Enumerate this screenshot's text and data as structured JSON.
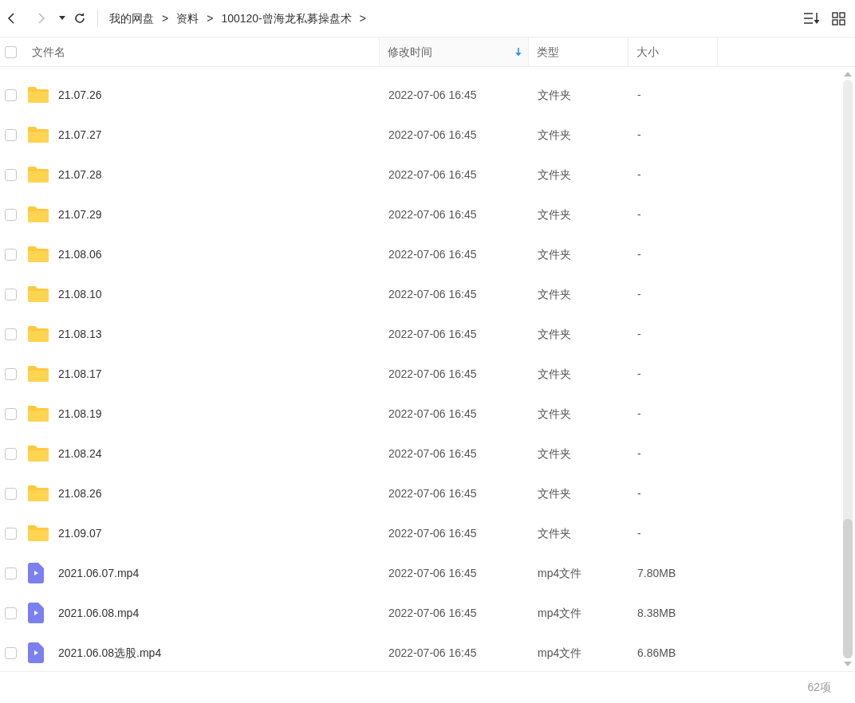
{
  "toolbar": {
    "breadcrumbs": [
      "我的网盘",
      "资料",
      "100120-曾海龙私募操盘术"
    ],
    "separator": ">"
  },
  "header": {
    "select_all": {
      "checked": false
    },
    "columns": [
      {
        "label": "文件名",
        "sorted": false
      },
      {
        "label": "修改时间",
        "sorted": true
      },
      {
        "label": "类型",
        "sorted": false
      },
      {
        "label": "大小",
        "sorted": false
      }
    ]
  },
  "rows": [
    {
      "kind": "folder",
      "name": "21.07.26",
      "modified": "2022-07-06 16:45",
      "type": "文件夹",
      "size": "-",
      "checked": false
    },
    {
      "kind": "folder",
      "name": "21.07.27",
      "modified": "2022-07-06 16:45",
      "type": "文件夹",
      "size": "-",
      "checked": false
    },
    {
      "kind": "folder",
      "name": "21.07.28",
      "modified": "2022-07-06 16:45",
      "type": "文件夹",
      "size": "-",
      "checked": false
    },
    {
      "kind": "folder",
      "name": "21.07.29",
      "modified": "2022-07-06 16:45",
      "type": "文件夹",
      "size": "-",
      "checked": false
    },
    {
      "kind": "folder",
      "name": "21.08.06",
      "modified": "2022-07-06 16:45",
      "type": "文件夹",
      "size": "-",
      "checked": false
    },
    {
      "kind": "folder",
      "name": "21.08.10",
      "modified": "2022-07-06 16:45",
      "type": "文件夹",
      "size": "-",
      "checked": false
    },
    {
      "kind": "folder",
      "name": "21.08.13",
      "modified": "2022-07-06 16:45",
      "type": "文件夹",
      "size": "-",
      "checked": false
    },
    {
      "kind": "folder",
      "name": "21.08.17",
      "modified": "2022-07-06 16:45",
      "type": "文件夹",
      "size": "-",
      "checked": false
    },
    {
      "kind": "folder",
      "name": "21.08.19",
      "modified": "2022-07-06 16:45",
      "type": "文件夹",
      "size": "-",
      "checked": false
    },
    {
      "kind": "folder",
      "name": "21.08.24",
      "modified": "2022-07-06 16:45",
      "type": "文件夹",
      "size": "-",
      "checked": false
    },
    {
      "kind": "folder",
      "name": "21.08.26",
      "modified": "2022-07-06 16:45",
      "type": "文件夹",
      "size": "-",
      "checked": false
    },
    {
      "kind": "folder",
      "name": "21.09.07",
      "modified": "2022-07-06 16:45",
      "type": "文件夹",
      "size": "-",
      "checked": false
    },
    {
      "kind": "video",
      "name": "2021.06.07.mp4",
      "modified": "2022-07-06 16:45",
      "type": "mp4文件",
      "size": "7.80MB",
      "checked": false
    },
    {
      "kind": "video",
      "name": "2021.06.08.mp4",
      "modified": "2022-07-06 16:45",
      "type": "mp4文件",
      "size": "8.38MB",
      "checked": false
    },
    {
      "kind": "video",
      "name": "2021.06.08选股.mp4",
      "modified": "2022-07-06 16:45",
      "type": "mp4文件",
      "size": "6.86MB",
      "checked": false
    }
  ],
  "status_bar": {
    "count": "62项"
  }
}
